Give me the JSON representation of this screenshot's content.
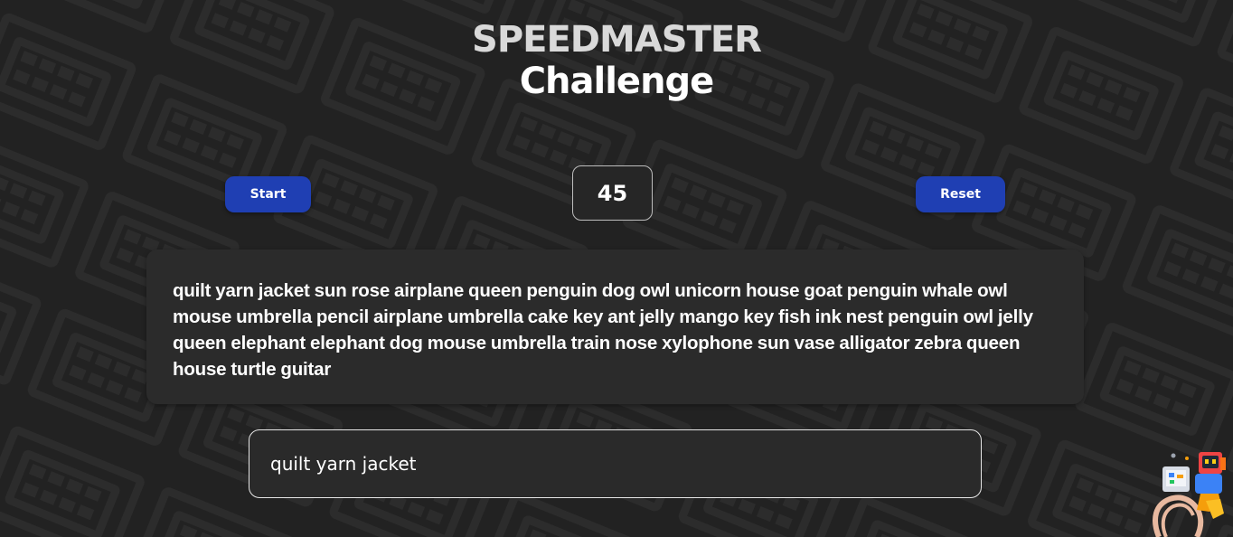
{
  "title": {
    "line1": "SPEEDMASTER",
    "line2": "Challenge"
  },
  "controls": {
    "start_label": "Start",
    "reset_label": "Reset",
    "timer_value": "45"
  },
  "word_list": {
    "text": "quilt yarn jacket sun rose airplane queen penguin dog owl unicorn house goat penguin whale owl mouse umbrella pencil airplane umbrella cake key ant jelly mango key fish ink nest penguin owl jelly queen elephant elephant dog mouse umbrella train nose xylophone sun vase alligator zebra queen house turtle guitar"
  },
  "typing_input": {
    "value": "quilt yarn jacket"
  },
  "colors": {
    "background": "#222222",
    "panel": "#2b2b2b",
    "button": "#1f3fb3",
    "title_primary": "#d9d9d9"
  },
  "icons": {
    "mascot": "typing-robot-icon",
    "background": "keyboard-pattern"
  }
}
